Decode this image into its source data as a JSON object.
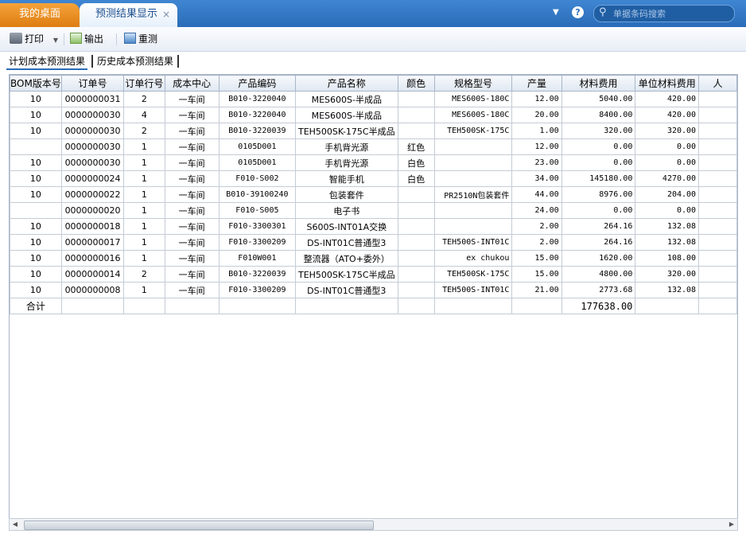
{
  "tabs": {
    "home": "我的桌面",
    "active": "预测结果显示",
    "close": "×"
  },
  "header": {
    "help": "?",
    "search_placeholder": "单据条码搜索"
  },
  "toolbar": {
    "print": "打印",
    "export": "输出",
    "reset": "重测"
  },
  "subtabs": [
    "计划成本预测结果",
    "历史成本预测结果"
  ],
  "table": {
    "columns": [
      "BOM版本号",
      "订单号",
      "订单行号",
      "成本中心",
      "产品编码",
      "产品名称",
      "颜色",
      "规格型号",
      "产量",
      "材料费用",
      "单位材料费用",
      "人"
    ],
    "rows": [
      [
        "10",
        "0000000031",
        "2",
        "一车间",
        "B010-3220040",
        "MES600S-半成品",
        "",
        "MES600S-180C",
        "12.00",
        "5040.00",
        "420.00",
        ""
      ],
      [
        "10",
        "0000000030",
        "4",
        "一车间",
        "B010-3220040",
        "MES600S-半成品",
        "",
        "MES600S-180C",
        "20.00",
        "8400.00",
        "420.00",
        ""
      ],
      [
        "10",
        "0000000030",
        "2",
        "一车间",
        "B010-3220039",
        "TEH500SK-175C半成品",
        "",
        "TEH500SK-175C",
        "1.00",
        "320.00",
        "320.00",
        ""
      ],
      [
        "",
        "0000000030",
        "1",
        "一车间",
        "0105D001",
        "手机背光源",
        "红色",
        "",
        "12.00",
        "0.00",
        "0.00",
        ""
      ],
      [
        "10",
        "0000000030",
        "1",
        "一车间",
        "0105D001",
        "手机背光源",
        "白色",
        "",
        "23.00",
        "0.00",
        "0.00",
        ""
      ],
      [
        "10",
        "0000000024",
        "1",
        "一车间",
        "F010-S002",
        "智能手机",
        "白色",
        "",
        "34.00",
        "145180.00",
        "4270.00",
        ""
      ],
      [
        "10",
        "0000000022",
        "1",
        "一车间",
        "B010-39100240",
        "包装套件",
        "",
        "PR2510N包装套件",
        "44.00",
        "8976.00",
        "204.00",
        ""
      ],
      [
        "",
        "0000000020",
        "1",
        "一车间",
        "F010-S005",
        "电子书",
        "",
        "",
        "24.00",
        "0.00",
        "0.00",
        ""
      ],
      [
        "10",
        "0000000018",
        "1",
        "一车间",
        "F010-3300301",
        "S600S-INT01A交换",
        "",
        "",
        "2.00",
        "264.16",
        "132.08",
        ""
      ],
      [
        "10",
        "0000000017",
        "1",
        "一车间",
        "F010-3300209",
        "DS-INT01C普通型3",
        "",
        "TEH500S-INT01C",
        "2.00",
        "264.16",
        "132.08",
        ""
      ],
      [
        "10",
        "0000000016",
        "1",
        "一车间",
        "F010W001",
        "整流器（ATO+委外）",
        "",
        "ex chukou",
        "15.00",
        "1620.00",
        "108.00",
        ""
      ],
      [
        "10",
        "0000000014",
        "2",
        "一车间",
        "B010-3220039",
        "TEH500SK-175C半成品",
        "",
        "TEH500SK-175C",
        "15.00",
        "4800.00",
        "320.00",
        ""
      ],
      [
        "10",
        "0000000008",
        "1",
        "一车间",
        "F010-3300209",
        "DS-INT01C普通型3",
        "",
        "TEH500S-INT01C",
        "21.00",
        "2773.68",
        "132.08",
        ""
      ]
    ],
    "total_label": "合计",
    "total_material": "177638.00"
  },
  "scrollbar": {
    "left": "◀",
    "right": "▶"
  }
}
